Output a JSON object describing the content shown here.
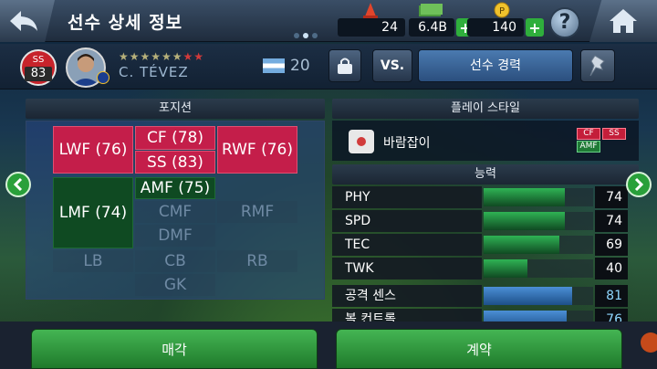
{
  "header": {
    "title": "선수 상세 정보",
    "resources": {
      "cones": "24",
      "cash": "6.4B",
      "points": "140"
    },
    "help_label": "?"
  },
  "player": {
    "position": "SS",
    "overall": "83",
    "name": "C. TÉVEZ",
    "age": "20",
    "stars_gold": "★★★★★★",
    "stars_red": "★★",
    "buttons": {
      "vs": "VS.",
      "career": "선수 경력"
    }
  },
  "positions_panel": {
    "title": "포지션",
    "cells": {
      "lwf": "LWF (76)",
      "cf": "CF (78)",
      "ss": "SS (83)",
      "rwf": "RWF (76)",
      "lmf": "LMF (74)",
      "amf": "AMF (75)",
      "cmf": "CMF",
      "rmf": "RMF",
      "dmf": "DMF",
      "lb": "LB",
      "cb": "CB",
      "rb": "RB",
      "gk": "GK"
    }
  },
  "playstyle": {
    "title": "플레이 스타일",
    "name": "바람잡이",
    "tags": [
      "CF",
      "SS",
      "AMF"
    ]
  },
  "abilities": {
    "title": "능력",
    "stats": [
      {
        "label": "PHY",
        "value": "74",
        "fraction": 0.74,
        "color": "#2fb354"
      },
      {
        "label": "SPD",
        "value": "74",
        "fraction": 0.74,
        "color": "#2fb354"
      },
      {
        "label": "TEC",
        "value": "69",
        "fraction": 0.69,
        "color": "#2fb354"
      },
      {
        "label": "TWK",
        "value": "40",
        "fraction": 0.4,
        "color": "#2fb354"
      },
      {
        "label": "공격 센스",
        "value": "81",
        "fraction": 0.81,
        "color": "#3f7fc7"
      },
      {
        "label": "볼 컨트롤",
        "value": "76",
        "fraction": 0.76,
        "color": "#3f7fc7"
      }
    ]
  },
  "footer": {
    "sell": "매각",
    "contract": "계약"
  }
}
